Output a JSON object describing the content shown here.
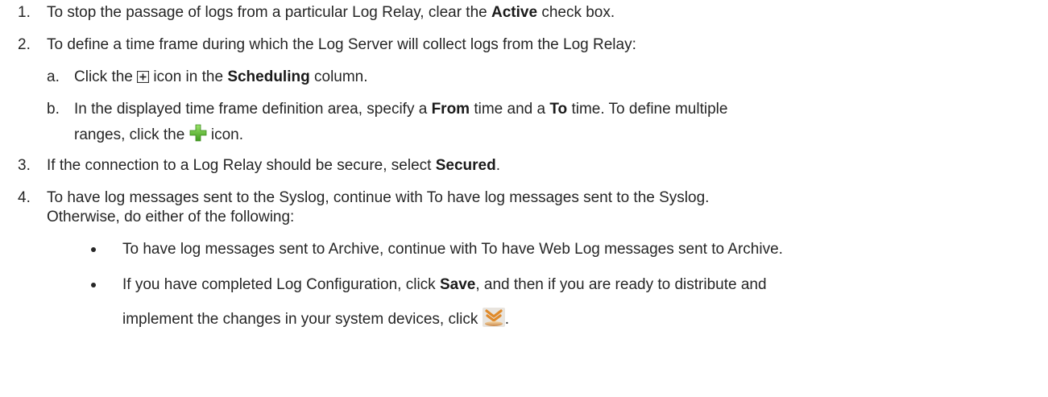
{
  "steps": [
    {
      "number": "1.",
      "segments": [
        "To stop the passage of logs from a particular Log Relay, clear the ",
        "Active",
        " check box."
      ]
    },
    {
      "number": "2.",
      "text": "To define a time frame during which the Log Server will collect logs from the Log Relay:",
      "substeps": [
        {
          "letter": "a.",
          "pre": "Click the ",
          "icon": "expand-plus-icon",
          "mid": " icon in the ",
          "bold": "Scheduling",
          "post": " column."
        },
        {
          "letter": "b.",
          "line1_pre": "In the displayed time frame definition area, specify a ",
          "line1_bold1": "From",
          "line1_mid": " time and a ",
          "line1_bold2": "To",
          "line1_post": " time. To define multiple",
          "line2_pre": "ranges, click the ",
          "icon": "green-add-plus-icon",
          "line2_post": " icon."
        }
      ]
    },
    {
      "number": "3.",
      "segments": [
        "If the connection to a Log Relay should be secure, select ",
        "Secured",
        "."
      ]
    },
    {
      "number": "4.",
      "line1": "To have log messages sent to the Syslog, continue with To have log messages sent to the Syslog.",
      "line2": "Otherwise, do either of the following:",
      "bullets": [
        {
          "text": "To have log messages sent to Archive, continue with To have Web Log messages sent to Archive."
        },
        {
          "line1_pre": "If you have completed Log Configuration, click ",
          "line1_bold": "Save",
          "line1_post": ", and then if you are ready to distribute and",
          "line2_pre": "implement the changes in your system devices, click ",
          "icon": "distribute-icon",
          "line2_post": "."
        }
      ]
    }
  ]
}
